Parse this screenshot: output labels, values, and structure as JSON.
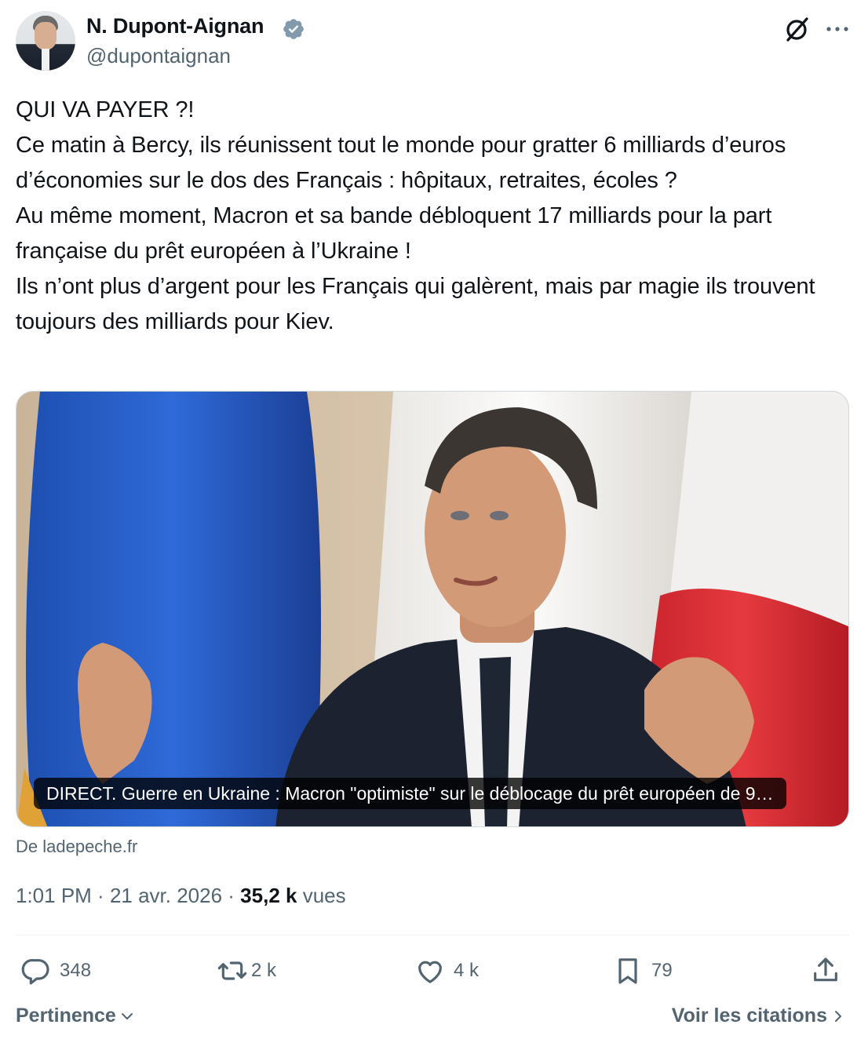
{
  "author": {
    "display_name": "N. Dupont-Aignan",
    "handle": "@dupontaignan",
    "verified_icon": "verified-badge-icon"
  },
  "tweet": {
    "lines": [
      "QUI VA PAYER ?!",
      "Ce matin à Bercy, ils réunissent tout le monde pour gratter 6 milliards d’euros d’économies sur le dos des Français : hôpitaux, retraites, écoles ?",
      "Au même moment, Macron et sa bande débloquent 17 milliards pour la part française du prêt européen à l’Ukraine !",
      "Ils n’ont plus d’argent pour les Français qui galèrent, mais par magie ils trouvent toujours des milliards pour Kiev."
    ]
  },
  "card": {
    "caption": "DIRECT. Guerre en Ukraine : Macron \"optimiste\" sur le déblocage du prêt européen de 9…",
    "source": "De ladepeche.fr"
  },
  "meta": {
    "time": "1:01 PM",
    "sep1": " · ",
    "date": "21 avr. 2026",
    "sep2": " · ",
    "views_count": "35,2 k",
    "views_label": " vues"
  },
  "actions": {
    "replies": "348",
    "reposts": "2 k",
    "likes": "4 k",
    "bookmarks": "79"
  },
  "footer": {
    "sort_label": "Pertinence",
    "quotes_label": "Voir les citations"
  },
  "colors": {
    "text": "#0f1419",
    "secondary": "#536471",
    "verified_blue": "#829aab",
    "border": "#cfd9de"
  }
}
